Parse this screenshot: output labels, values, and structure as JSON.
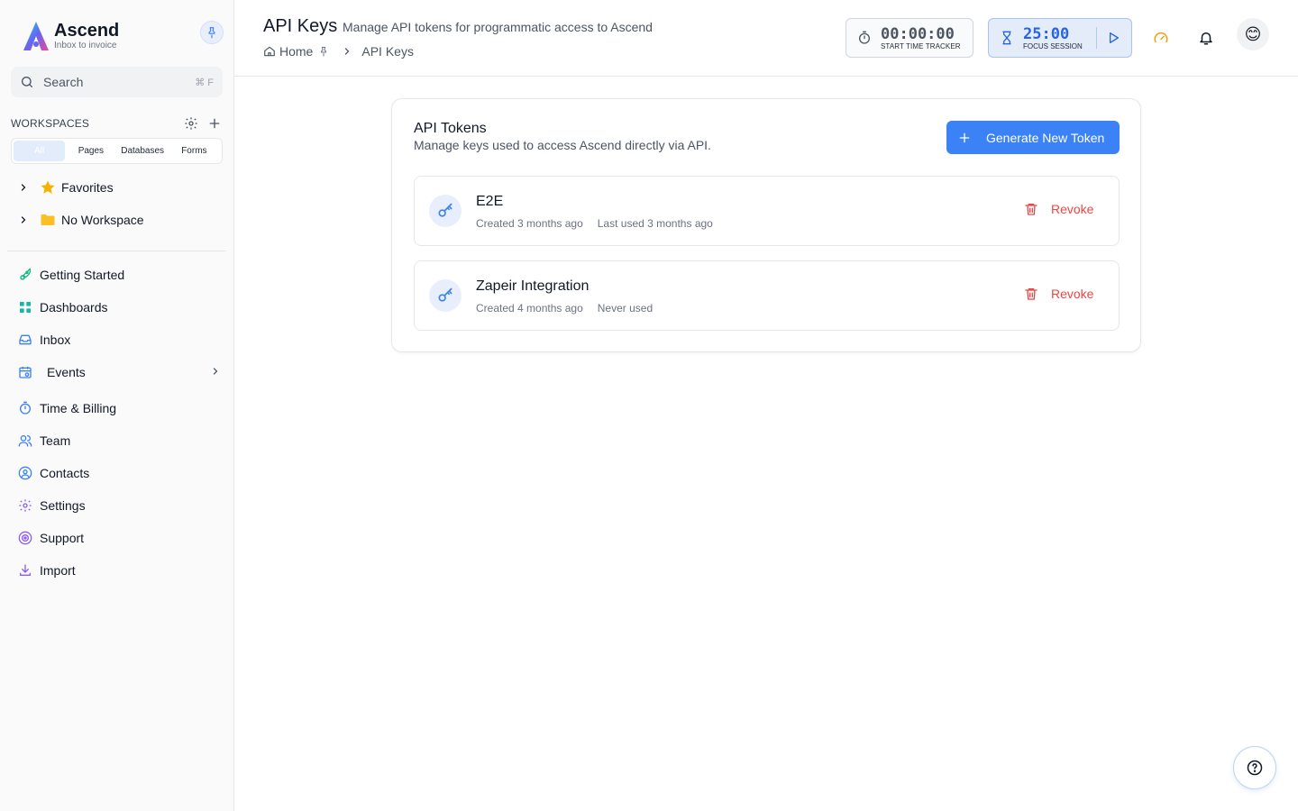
{
  "brand": {
    "name": "Ascend",
    "tagline": "Inbox to invoice"
  },
  "search": {
    "placeholder": "Search",
    "shortcut": "⌘ F"
  },
  "workspaces": {
    "title": "WORKSPACES",
    "filters": [
      "All",
      "Pages",
      "Databases",
      "Forms"
    ],
    "tree": [
      {
        "label": "Favorites",
        "icon": "star-icon"
      },
      {
        "label": "No Workspace",
        "icon": "folder-icon"
      }
    ]
  },
  "nav": [
    {
      "label": "Getting Started",
      "icon": "rocket-icon",
      "color": "#10b981"
    },
    {
      "label": "Dashboards",
      "icon": "grid-icon",
      "color": "#14b8a6"
    },
    {
      "label": "Inbox",
      "icon": "inbox-icon",
      "color": "#3b82f6"
    },
    {
      "label": "Events",
      "icon": "calendar-icon",
      "color": "#3b82f6"
    },
    {
      "label": "Time & Billing",
      "icon": "timer-icon",
      "color": "#3b82f6"
    },
    {
      "label": "Team",
      "icon": "users-icon",
      "color": "#3b82f6"
    },
    {
      "label": "Contacts",
      "icon": "contact-icon",
      "color": "#3b82f6"
    },
    {
      "label": "Settings",
      "icon": "gear-icon",
      "color": "#8b5cf6"
    },
    {
      "label": "Support",
      "icon": "lifebuoy-icon",
      "color": "#8b5cf6"
    },
    {
      "label": "Import",
      "icon": "download-icon",
      "color": "#8b5cf6"
    }
  ],
  "header": {
    "title": "API Keys",
    "subtitle": "Manage API tokens for programmatic access to Ascend",
    "breadcrumb": [
      "Home",
      "API Keys"
    ]
  },
  "tracker": {
    "time": "00:00:00",
    "label": "START TIME TRACKER"
  },
  "focus": {
    "time": "25:00",
    "label": "FOCUS SESSION"
  },
  "colors": {
    "accent": "#3b82f6",
    "danger": "#ef4444"
  },
  "card": {
    "title": "API Tokens",
    "subtitle": "Manage keys used to access Ascend directly via API.",
    "generate_label": "Generate New Token",
    "revoke_label": "Revoke",
    "tokens": [
      {
        "name": "E2E",
        "created": "Created 3 months ago",
        "last_used": "Last used 3 months ago"
      },
      {
        "name": "Zapeir Integration",
        "created": "Created 4 months ago",
        "last_used": "Never used"
      }
    ]
  }
}
